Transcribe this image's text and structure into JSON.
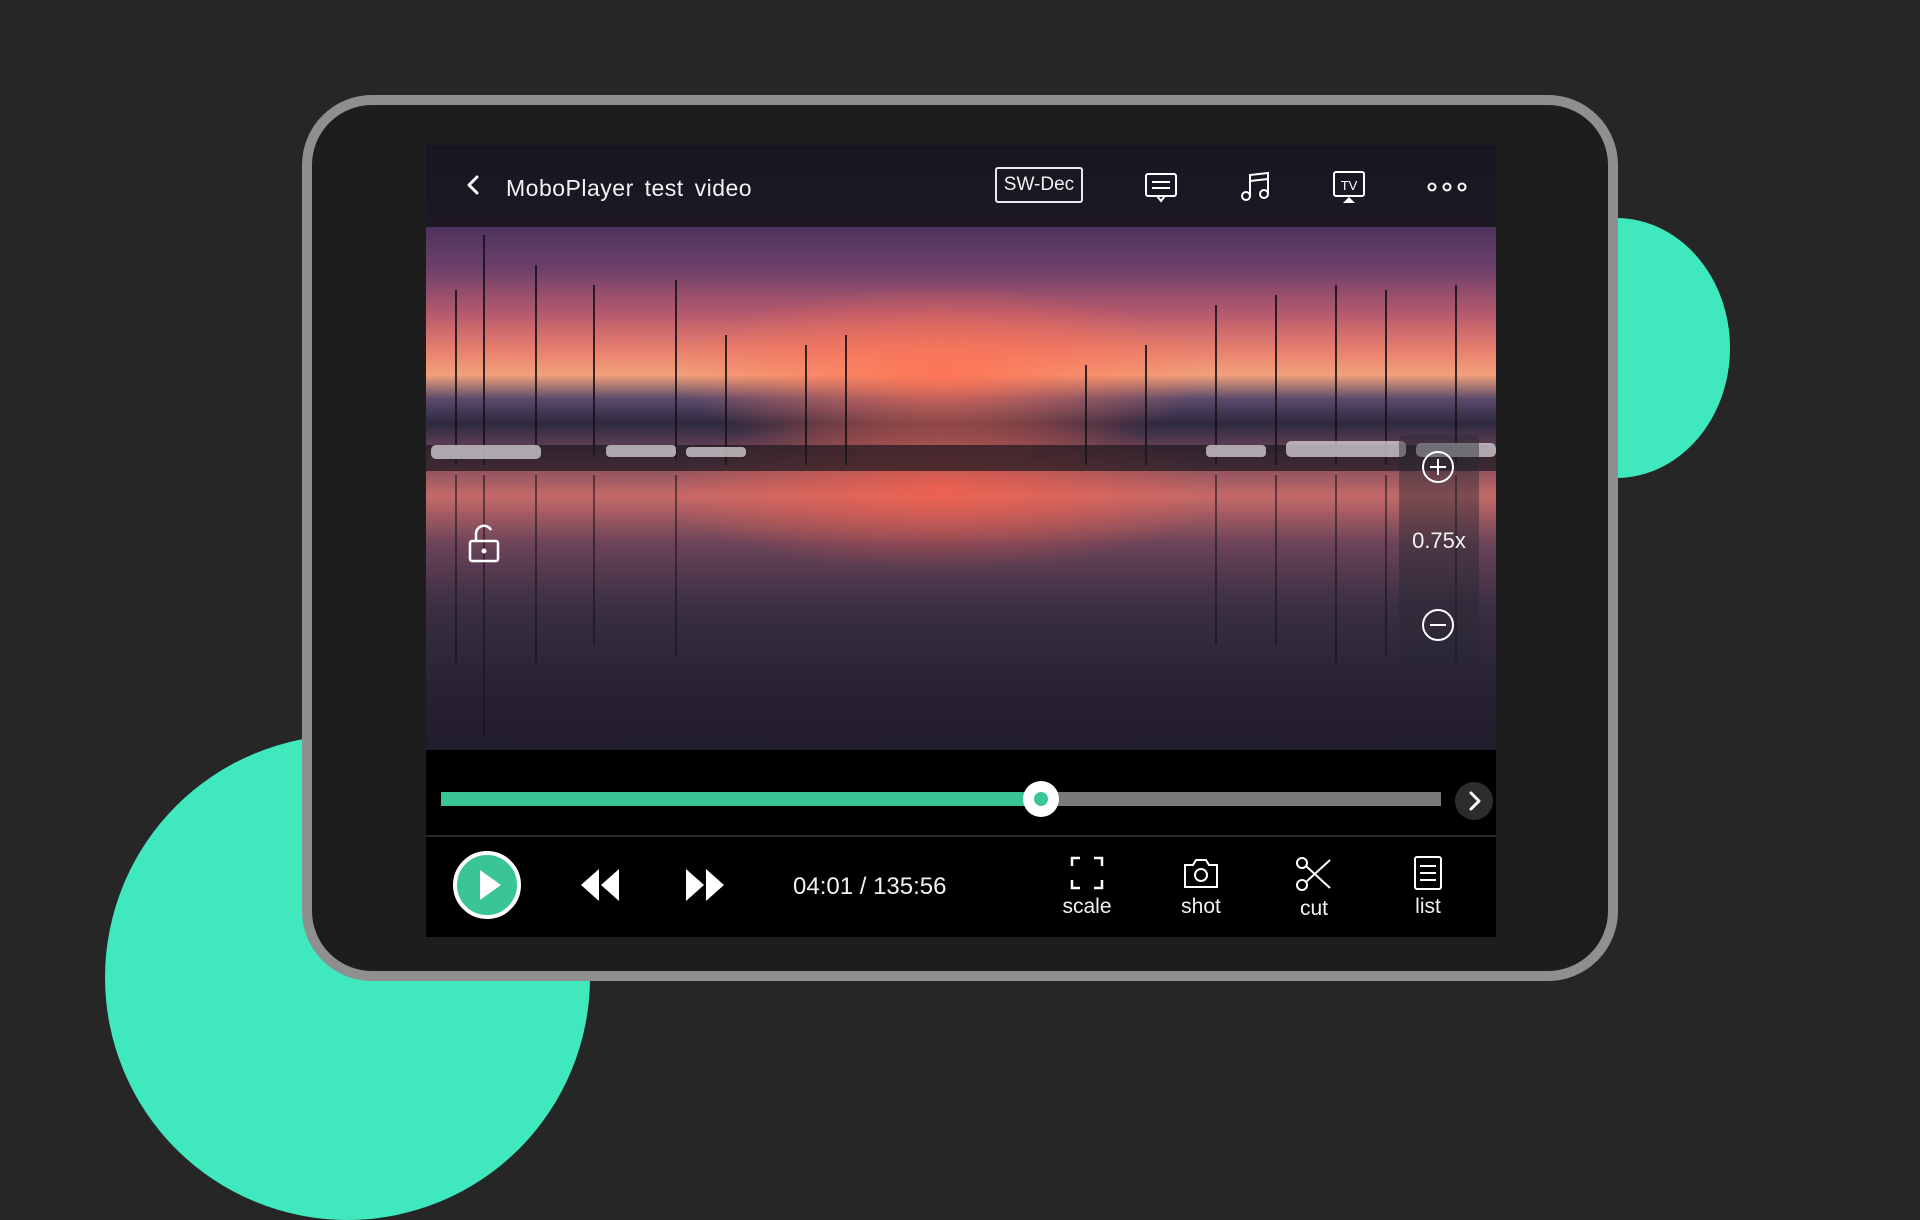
{
  "player": {
    "title": "MoboPlayer test video",
    "decoder_label": "SW-Dec",
    "speed": "0.75x",
    "time": "04:01 / 135:56",
    "progress_fraction": 0.6
  },
  "top_icons": [
    "back-icon",
    "subtitle-icon",
    "music-icon",
    "tv-cast-icon",
    "more-icon"
  ],
  "side_icons": [
    "unlock-icon",
    "zoom-in-icon",
    "zoom-out-icon"
  ],
  "tools": [
    {
      "label": "scale",
      "icon": "scale-icon"
    },
    {
      "label": "shot",
      "icon": "camera-icon"
    },
    {
      "label": "cut",
      "icon": "scissors-icon"
    },
    {
      "label": "list",
      "icon": "list-icon"
    }
  ],
  "colors": {
    "accent": "#39c598",
    "background": "#262626",
    "blob": "#3fe8bd",
    "tablet_bezel": "#8f8f8f"
  }
}
